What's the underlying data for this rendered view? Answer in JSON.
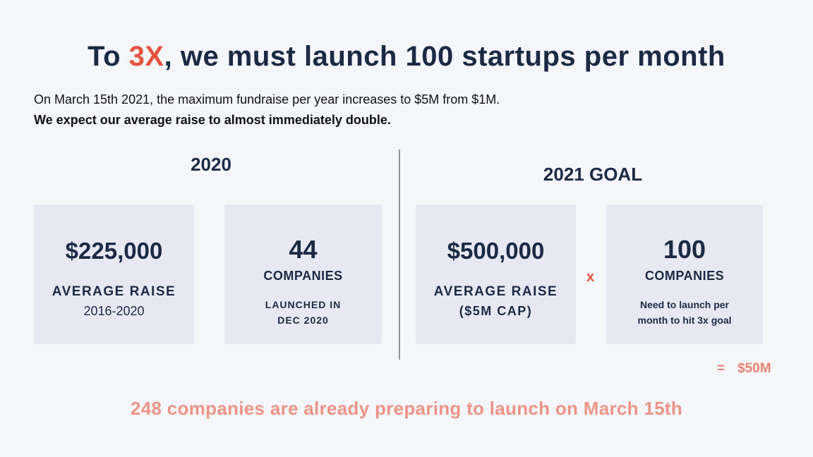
{
  "title": {
    "before": "To ",
    "accent": "3X",
    "after": ", we must launch 100 startups per month"
  },
  "intro": {
    "line1": "On March 15th 2021, the maximum fundraise per year increases to $5M from $1M.",
    "line2": "We expect our average raise to almost immediately double."
  },
  "section_2020": {
    "heading": "2020",
    "card_raise": {
      "value": "$225,000",
      "label": "AVERAGE RAISE",
      "sub": "2016-2020"
    },
    "card_companies": {
      "value": "44",
      "label": "COMPANIES",
      "sub_line1": "LAUNCHED IN",
      "sub_line2": "DEC 2020"
    }
  },
  "section_2021": {
    "heading": "2021 GOAL",
    "card_raise": {
      "value": "$500,000",
      "label": "AVERAGE RAISE",
      "sub": "($5M CAP)"
    },
    "operator": "x",
    "card_companies": {
      "value": "100",
      "label": "COMPANIES",
      "sub_line1": "Need to launch per",
      "sub_line2": "month to hit 3x goal"
    },
    "equals": "=",
    "total": "$50M"
  },
  "footer": "248 companies are already preparing to launch on March 15th",
  "colors": {
    "accent": "#e5533d",
    "accent_light": "#ed9485",
    "navy": "#1b2a44",
    "card_bg": "#e6e9f1",
    "page_bg": "#f4f6fa"
  }
}
